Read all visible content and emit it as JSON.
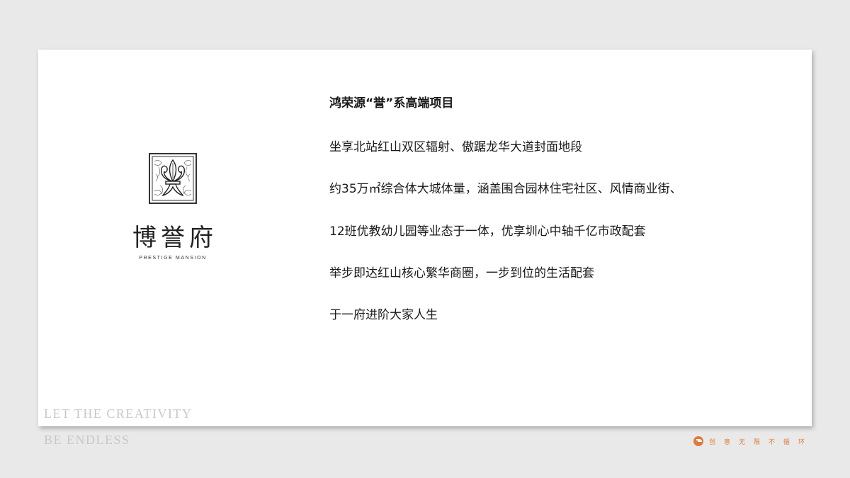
{
  "logo": {
    "name_cn": "博誉府",
    "name_en": "PRESTIGE MANSION"
  },
  "content": {
    "headline": "鸿荣源“誉”系高端项目",
    "lines": [
      "坐享北站红山双区辐射、傲踞龙华大道封面地段",
      "约35万㎡综合体大城体量，涵盖围合园林住宅社区、风情商业街、",
      "12班优教幼儿园等业态于一体，优享圳心中轴千亿市政配套",
      "举步即达红山核心繁华商圈，一步到位的生活配套",
      "于一府进阶大家人生"
    ]
  },
  "slogan": {
    "line1": "LET THE CREATIVITY",
    "line2": "BE ENDLESS"
  },
  "footer": {
    "text": "创意无限不循环",
    "accent_color": "#e07b3a"
  }
}
